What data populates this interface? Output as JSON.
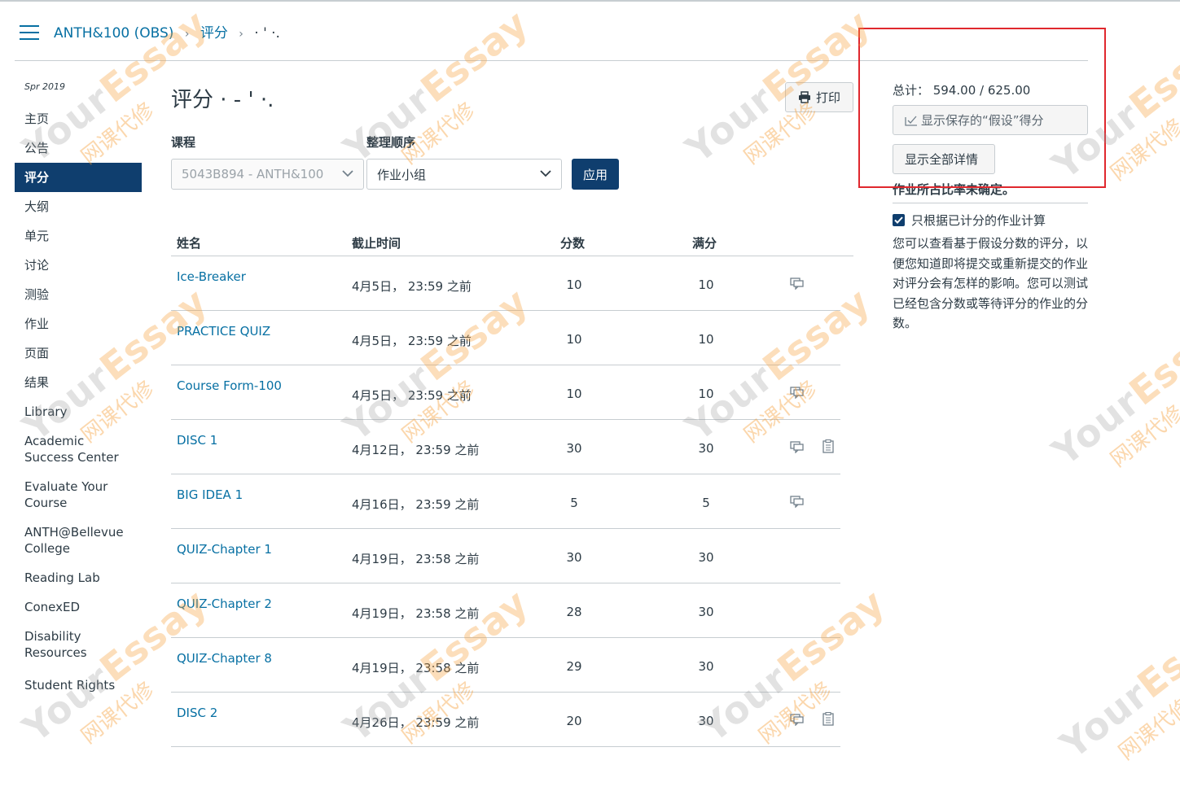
{
  "header": {
    "breadcrumbs": [
      "ANTH&100 (OBS)",
      "评分",
      "· ' ·."
    ],
    "separator": "›"
  },
  "sidebar": {
    "term": "Spr 2019",
    "items": [
      {
        "label": "主页"
      },
      {
        "label": "公告"
      },
      {
        "label": "评分",
        "active": true
      },
      {
        "label": "大纲"
      },
      {
        "label": "单元"
      },
      {
        "label": "讨论"
      },
      {
        "label": "测验"
      },
      {
        "label": "作业"
      },
      {
        "label": "页面"
      },
      {
        "label": "结果"
      },
      {
        "label": "Library"
      },
      {
        "label": "Academic Success Center"
      },
      {
        "label": "Evaluate Your Course"
      },
      {
        "label": "ANTH@Bellevue College"
      },
      {
        "label": "Reading Lab"
      },
      {
        "label": "ConexED"
      },
      {
        "label": "Disability Resources"
      },
      {
        "label": "Student Rights"
      }
    ]
  },
  "main": {
    "title": "评分 · - ' ·.",
    "print_label": "打印",
    "course_label": "课程",
    "course_value": "5043B894 - ANTH&100",
    "sort_label": "整理顺序",
    "sort_value": "作业小组",
    "apply_label": "应用"
  },
  "table": {
    "headers": {
      "name": "姓名",
      "due": "截止时间",
      "score": "分数",
      "total": "满分"
    },
    "rows": [
      {
        "name": "Ice-Breaker",
        "due": "4月5日， 23:59 之前",
        "score": "10",
        "total": "10",
        "comment_icon": true,
        "rubric_icon": false
      },
      {
        "name": "PRACTICE QUIZ",
        "due": "4月5日， 23:59 之前",
        "score": "10",
        "total": "10",
        "comment_icon": false,
        "rubric_icon": false
      },
      {
        "name": "Course Form-100",
        "due": "4月5日， 23:59 之前",
        "score": "10",
        "total": "10",
        "comment_icon": true,
        "rubric_icon": false
      },
      {
        "name": "DISC 1",
        "due": "4月12日， 23:59 之前",
        "score": "30",
        "total": "30",
        "comment_icon": true,
        "rubric_icon": true
      },
      {
        "name": "BIG IDEA 1",
        "due": "4月16日， 23:59 之前",
        "score": "5",
        "total": "5",
        "comment_icon": true,
        "rubric_icon": false
      },
      {
        "name": "QUIZ-Chapter 1",
        "due": "4月19日， 23:58 之前",
        "score": "30",
        "total": "30",
        "comment_icon": false,
        "rubric_icon": false
      },
      {
        "name": "QUIZ-Chapter 2",
        "due": "4月19日， 23:58 之前",
        "score": "28",
        "total": "30",
        "comment_icon": false,
        "rubric_icon": false
      },
      {
        "name": "QUIZ-Chapter 8",
        "due": "4月19日， 23:58 之前",
        "score": "29",
        "total": "30",
        "comment_icon": false,
        "rubric_icon": false
      },
      {
        "name": "DISC 2",
        "due": "4月26日， 23:59 之前",
        "score": "20",
        "total": "30",
        "comment_icon": true,
        "rubric_icon": true
      }
    ]
  },
  "right_panel": {
    "total_text": "总计： 594.00 / 625.00",
    "whatif_button": "显示保存的“假设”得分",
    "details_button": "显示全部详情",
    "weight_note": "作业所占比率未确定。",
    "checkbox_label": "只根据已计分的作业计算",
    "checkbox_checked": true,
    "description": "您可以查看基于假设分数的评分，以便您知道即将提交或重新提交的作业对评分会有怎样的影响。您可以测试已经包含分数或等待评分的作业的分数。"
  },
  "watermark": {
    "brand_a": "Your",
    "brand_b": "Essay",
    "tagline": "网课代修"
  },
  "colors": {
    "link": "#0770a3",
    "active_nav": "#0f3e6e",
    "text": "#2d3b45",
    "border": "#c7cdd1",
    "highlight_box": "#e0282e"
  }
}
